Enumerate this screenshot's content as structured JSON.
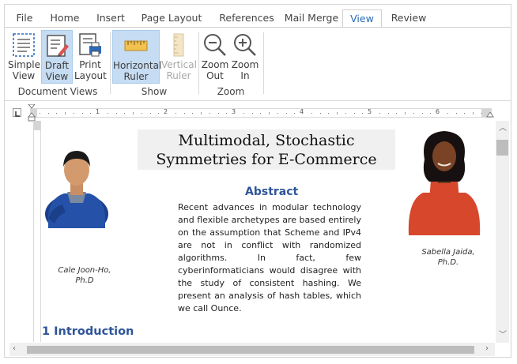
{
  "tabs": [
    {
      "label": "File"
    },
    {
      "label": "Home"
    },
    {
      "label": "Insert"
    },
    {
      "label": "Page Layout"
    },
    {
      "label": "References"
    },
    {
      "label": "Mail Merge"
    },
    {
      "label": "View"
    },
    {
      "label": "Review"
    }
  ],
  "active_tab": "View",
  "ribbon": {
    "document_views": {
      "group_label": "Document Views",
      "simple_line1": "Simple",
      "simple_line2": "View",
      "draft_line1": "Draft",
      "draft_line2": "View",
      "print_line1": "Print",
      "print_line2": "Layout"
    },
    "show": {
      "group_label": "Show",
      "hruler_line1": "Horizontal",
      "hruler_line2": "Ruler",
      "vruler_line1": "Vertical",
      "vruler_line2": "Ruler"
    },
    "zoom": {
      "group_label": "Zoom",
      "out_line1": "Zoom",
      "out_line2": "Out",
      "in_line1": "Zoom",
      "in_line2": "In"
    }
  },
  "ruler": {
    "numbers": [
      "1",
      "2",
      "3",
      "4",
      "5",
      "6"
    ]
  },
  "document": {
    "title_line1": "Multimodal, Stochastic",
    "title_line2": "Symmetries for E-Commerce",
    "left_author_line1": "Cale Joon-Ho,",
    "left_author_line2": "Ph.D",
    "right_author_line1": "Sabella Jaida,",
    "right_author_line2": "Ph.D.",
    "abstract_title": "Abstract",
    "abstract_text": "Recent advances in modular technology and flexible archetypes are based entirely on the assumption that Scheme and IPv4 are not in conflict with randomized algorithms. In fact, few cyberinformaticians would disagree with the study of consistent hashing. We present an analysis of hash tables, which we call Ounce.",
    "intro_heading": "1 Introduction"
  },
  "colors": {
    "accent": "#2a6ab8",
    "heading": "#2f5597",
    "selected_button": "#c6dcf2"
  }
}
